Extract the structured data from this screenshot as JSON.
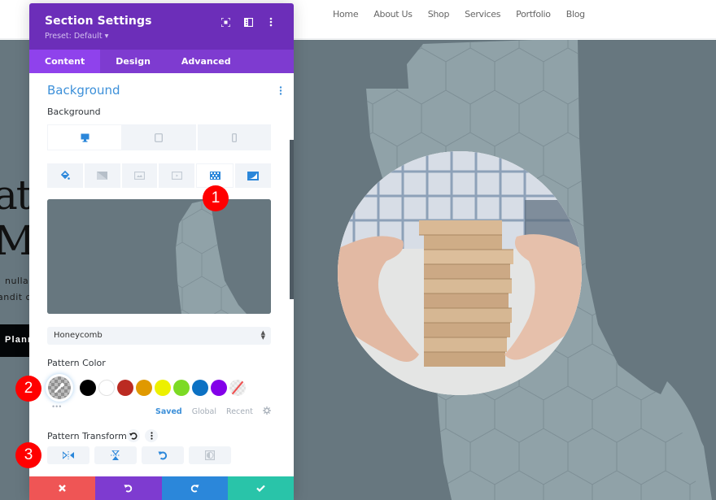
{
  "site": {
    "nav": [
      "Home",
      "About Us",
      "Shop",
      "Services",
      "Portfolio",
      "Blog"
    ],
    "hero": {
      "title_line1": "at",
      "title_line2": "Ma",
      "copy_line1": "nulla",
      "copy_line2": "andit c",
      "button_label": "Plann"
    }
  },
  "panel": {
    "title": "Section Settings",
    "preset": "Preset: Default ▾",
    "header_icons": [
      "focus-mode-icon",
      "split-view-icon",
      "more-options-icon"
    ],
    "tabs": [
      {
        "label": "Content",
        "active": true
      },
      {
        "label": "Design",
        "active": false
      },
      {
        "label": "Advanced",
        "active": false
      }
    ],
    "section_title": "Background",
    "background_label": "Background",
    "devices": [
      {
        "name": "desktop",
        "active": true
      },
      {
        "name": "tablet",
        "active": false
      },
      {
        "name": "phone",
        "active": false
      }
    ],
    "background_types": [
      {
        "name": "color",
        "active": false
      },
      {
        "name": "gradient",
        "active": false
      },
      {
        "name": "image",
        "active": false
      },
      {
        "name": "video",
        "active": false
      },
      {
        "name": "pattern",
        "active": true
      },
      {
        "name": "mask",
        "active": false
      }
    ],
    "pattern_select": "Honeycomb",
    "pattern_color_label": "Pattern Color",
    "swatches": [
      "#000000",
      "#ffffff",
      "#bb2b22",
      "#e09900",
      "#edf000",
      "#7cda24",
      "#0c71c3",
      "#8300e9"
    ],
    "palette_tabs": [
      {
        "label": "Saved",
        "active": true
      },
      {
        "label": "Global",
        "active": false
      },
      {
        "label": "Recent",
        "active": false
      }
    ],
    "pattern_transform_label": "Pattern Transform",
    "transform_buttons": [
      "flip-horizontal",
      "flip-vertical",
      "rotate",
      "invert"
    ],
    "footer": [
      "cancel",
      "undo",
      "redo",
      "save"
    ]
  },
  "annotations": [
    "1",
    "2",
    "3"
  ],
  "colors": {
    "header_purple": "#6c2eb9",
    "tab_purple": "#7e3bd0",
    "accent_blue": "#3d90d9",
    "hero_bg": "#67777f",
    "pattern_light": "#8fa1a8"
  }
}
